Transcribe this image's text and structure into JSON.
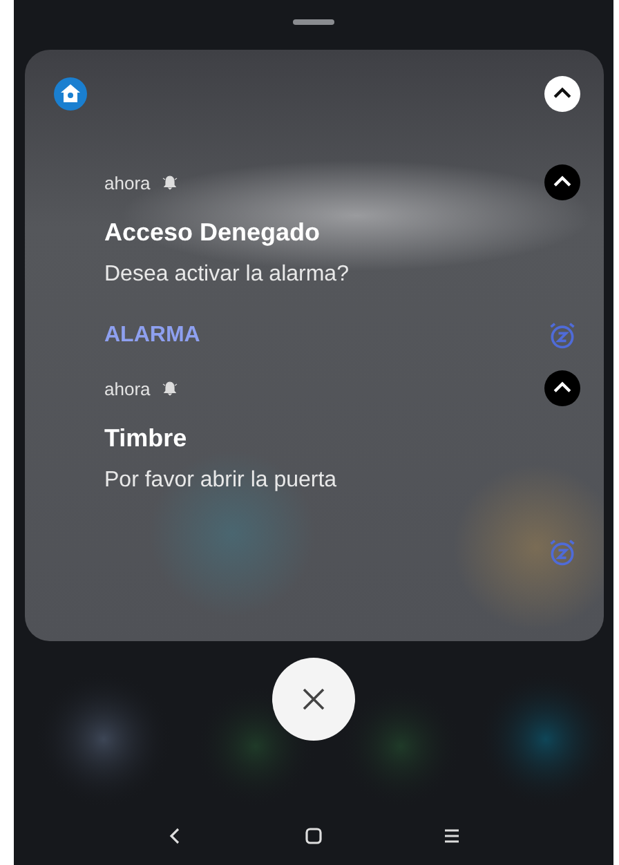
{
  "group": {
    "expanded": true
  },
  "notifications": [
    {
      "time": "ahora",
      "title": "Acceso Denegado",
      "body": "Desea activar la alarma?",
      "action": "ALARMA",
      "expanded": true
    },
    {
      "time": "ahora",
      "title": "Timbre",
      "body": "Por favor abrir la puerta",
      "expanded": true
    }
  ]
}
